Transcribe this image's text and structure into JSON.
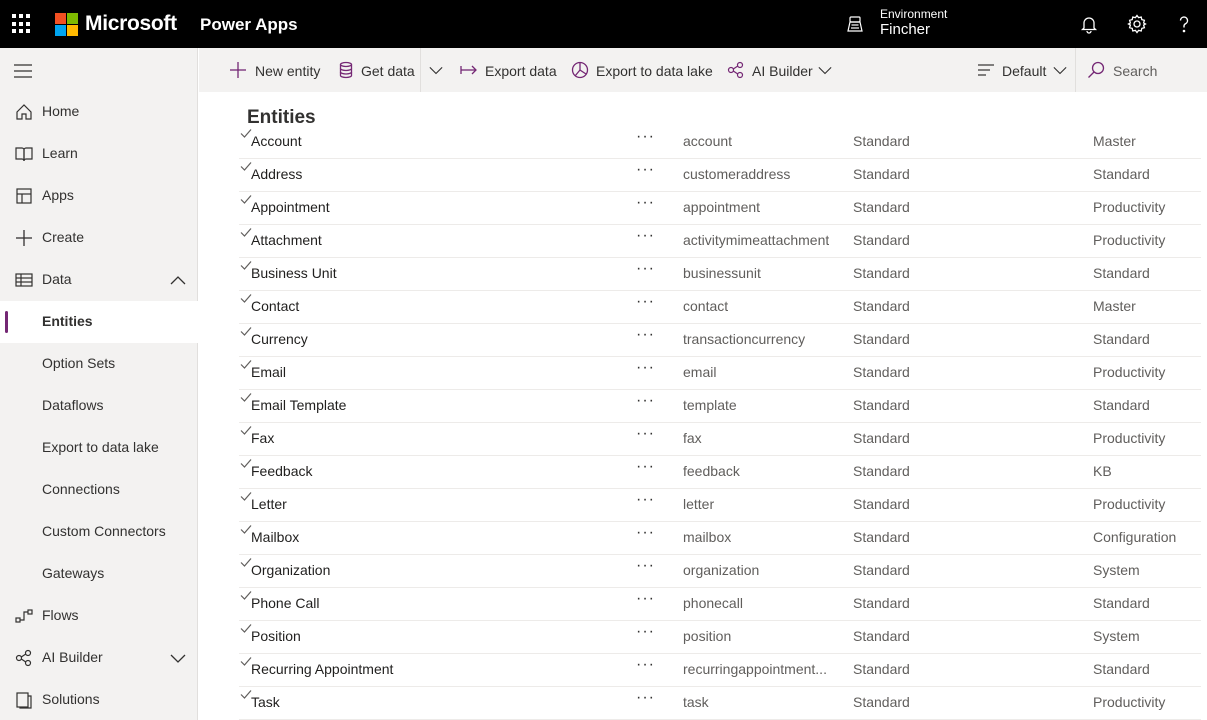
{
  "header": {
    "brand": "Microsoft",
    "app_name": "Power Apps",
    "environment_label": "Environment",
    "environment_name": "Fincher"
  },
  "colors": {
    "accent": "#742774",
    "topbar": "#000000",
    "logo": [
      "#f25022",
      "#7fba00",
      "#00a4ef",
      "#ffb900"
    ]
  },
  "sidebar": {
    "items": [
      {
        "label": "Home",
        "icon": "home-icon"
      },
      {
        "label": "Learn",
        "icon": "book-icon"
      },
      {
        "label": "Apps",
        "icon": "apps-icon"
      },
      {
        "label": "Create",
        "icon": "plus-icon"
      },
      {
        "label": "Data",
        "icon": "table-icon",
        "expanded": true
      },
      {
        "label": "Entities",
        "active": true
      },
      {
        "label": "Option Sets"
      },
      {
        "label": "Dataflows"
      },
      {
        "label": "Export to data lake"
      },
      {
        "label": "Connections"
      },
      {
        "label": "Custom Connectors"
      },
      {
        "label": "Gateways"
      },
      {
        "label": "Flows",
        "icon": "flow-icon"
      },
      {
        "label": "AI Builder",
        "icon": "ai-builder-icon",
        "expanded": false
      },
      {
        "label": "Solutions",
        "icon": "solutions-icon"
      }
    ]
  },
  "toolbar": {
    "new_entity": "New entity",
    "get_data": "Get data",
    "export_data": "Export data",
    "export_lake": "Export to data lake",
    "ai_builder": "AI Builder",
    "view": "Default",
    "search_placeholder": "Search"
  },
  "main": {
    "title": "Entities",
    "rows": [
      {
        "name": "Account",
        "more": "···",
        "system": "account",
        "type": "Standard",
        "tag": "Master"
      },
      {
        "name": "Address",
        "more": "···",
        "system": "customeraddress",
        "type": "Standard",
        "tag": "Standard"
      },
      {
        "name": "Appointment",
        "more": "···",
        "system": "appointment",
        "type": "Standard",
        "tag": "Productivity"
      },
      {
        "name": "Attachment",
        "more": "···",
        "system": "activitymimeattachment",
        "type": "Standard",
        "tag": "Productivity"
      },
      {
        "name": "Business Unit",
        "more": "···",
        "system": "businessunit",
        "type": "Standard",
        "tag": "Standard"
      },
      {
        "name": "Contact",
        "more": "···",
        "system": "contact",
        "type": "Standard",
        "tag": "Master"
      },
      {
        "name": "Currency",
        "more": "···",
        "system": "transactioncurrency",
        "type": "Standard",
        "tag": "Standard"
      },
      {
        "name": "Email",
        "more": "···",
        "system": "email",
        "type": "Standard",
        "tag": "Productivity"
      },
      {
        "name": "Email Template",
        "more": "···",
        "system": "template",
        "type": "Standard",
        "tag": "Standard"
      },
      {
        "name": "Fax",
        "more": "···",
        "system": "fax",
        "type": "Standard",
        "tag": "Productivity"
      },
      {
        "name": "Feedback",
        "more": "···",
        "system": "feedback",
        "type": "Standard",
        "tag": "KB"
      },
      {
        "name": "Letter",
        "more": "···",
        "system": "letter",
        "type": "Standard",
        "tag": "Productivity"
      },
      {
        "name": "Mailbox",
        "more": "···",
        "system": "mailbox",
        "type": "Standard",
        "tag": "Configuration"
      },
      {
        "name": "Organization",
        "more": "···",
        "system": "organization",
        "type": "Standard",
        "tag": "System"
      },
      {
        "name": "Phone Call",
        "more": "···",
        "system": "phonecall",
        "type": "Standard",
        "tag": "Standard"
      },
      {
        "name": "Position",
        "more": "···",
        "system": "position",
        "type": "Standard",
        "tag": "System"
      },
      {
        "name": "Recurring Appointment",
        "more": "···",
        "system": "recurringappointment...",
        "type": "Standard",
        "tag": "Standard"
      },
      {
        "name": "Task",
        "more": "···",
        "system": "task",
        "type": "Standard",
        "tag": "Productivity"
      }
    ]
  }
}
